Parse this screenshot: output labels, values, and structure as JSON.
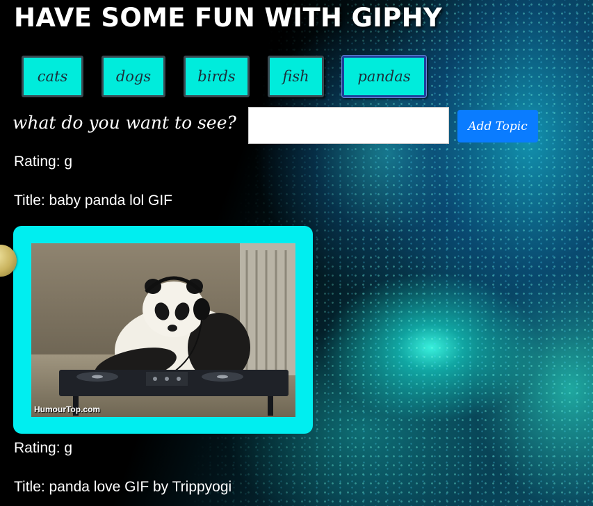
{
  "header": {
    "title": "HAVE SOME FUN WITH GIPHY"
  },
  "topics": [
    {
      "label": "cats"
    },
    {
      "label": "dogs"
    },
    {
      "label": "birds"
    },
    {
      "label": "fish"
    },
    {
      "label": "pandas",
      "active": true
    }
  ],
  "search": {
    "prompt": "what do you want to see?",
    "value": "",
    "button_label": "Add Topic"
  },
  "results": [
    {
      "rating": "Rating: g",
      "title": "Title: baby panda lol GIF",
      "watermark": "HumourTop.com"
    },
    {
      "rating": "Rating: g",
      "title": "Title: panda love GIF by Trippyogi"
    }
  ],
  "colors": {
    "topic_button_bg": "#00ecdc",
    "add_button_bg": "#0a7cff",
    "gif_card_bg": "#00eef0"
  }
}
